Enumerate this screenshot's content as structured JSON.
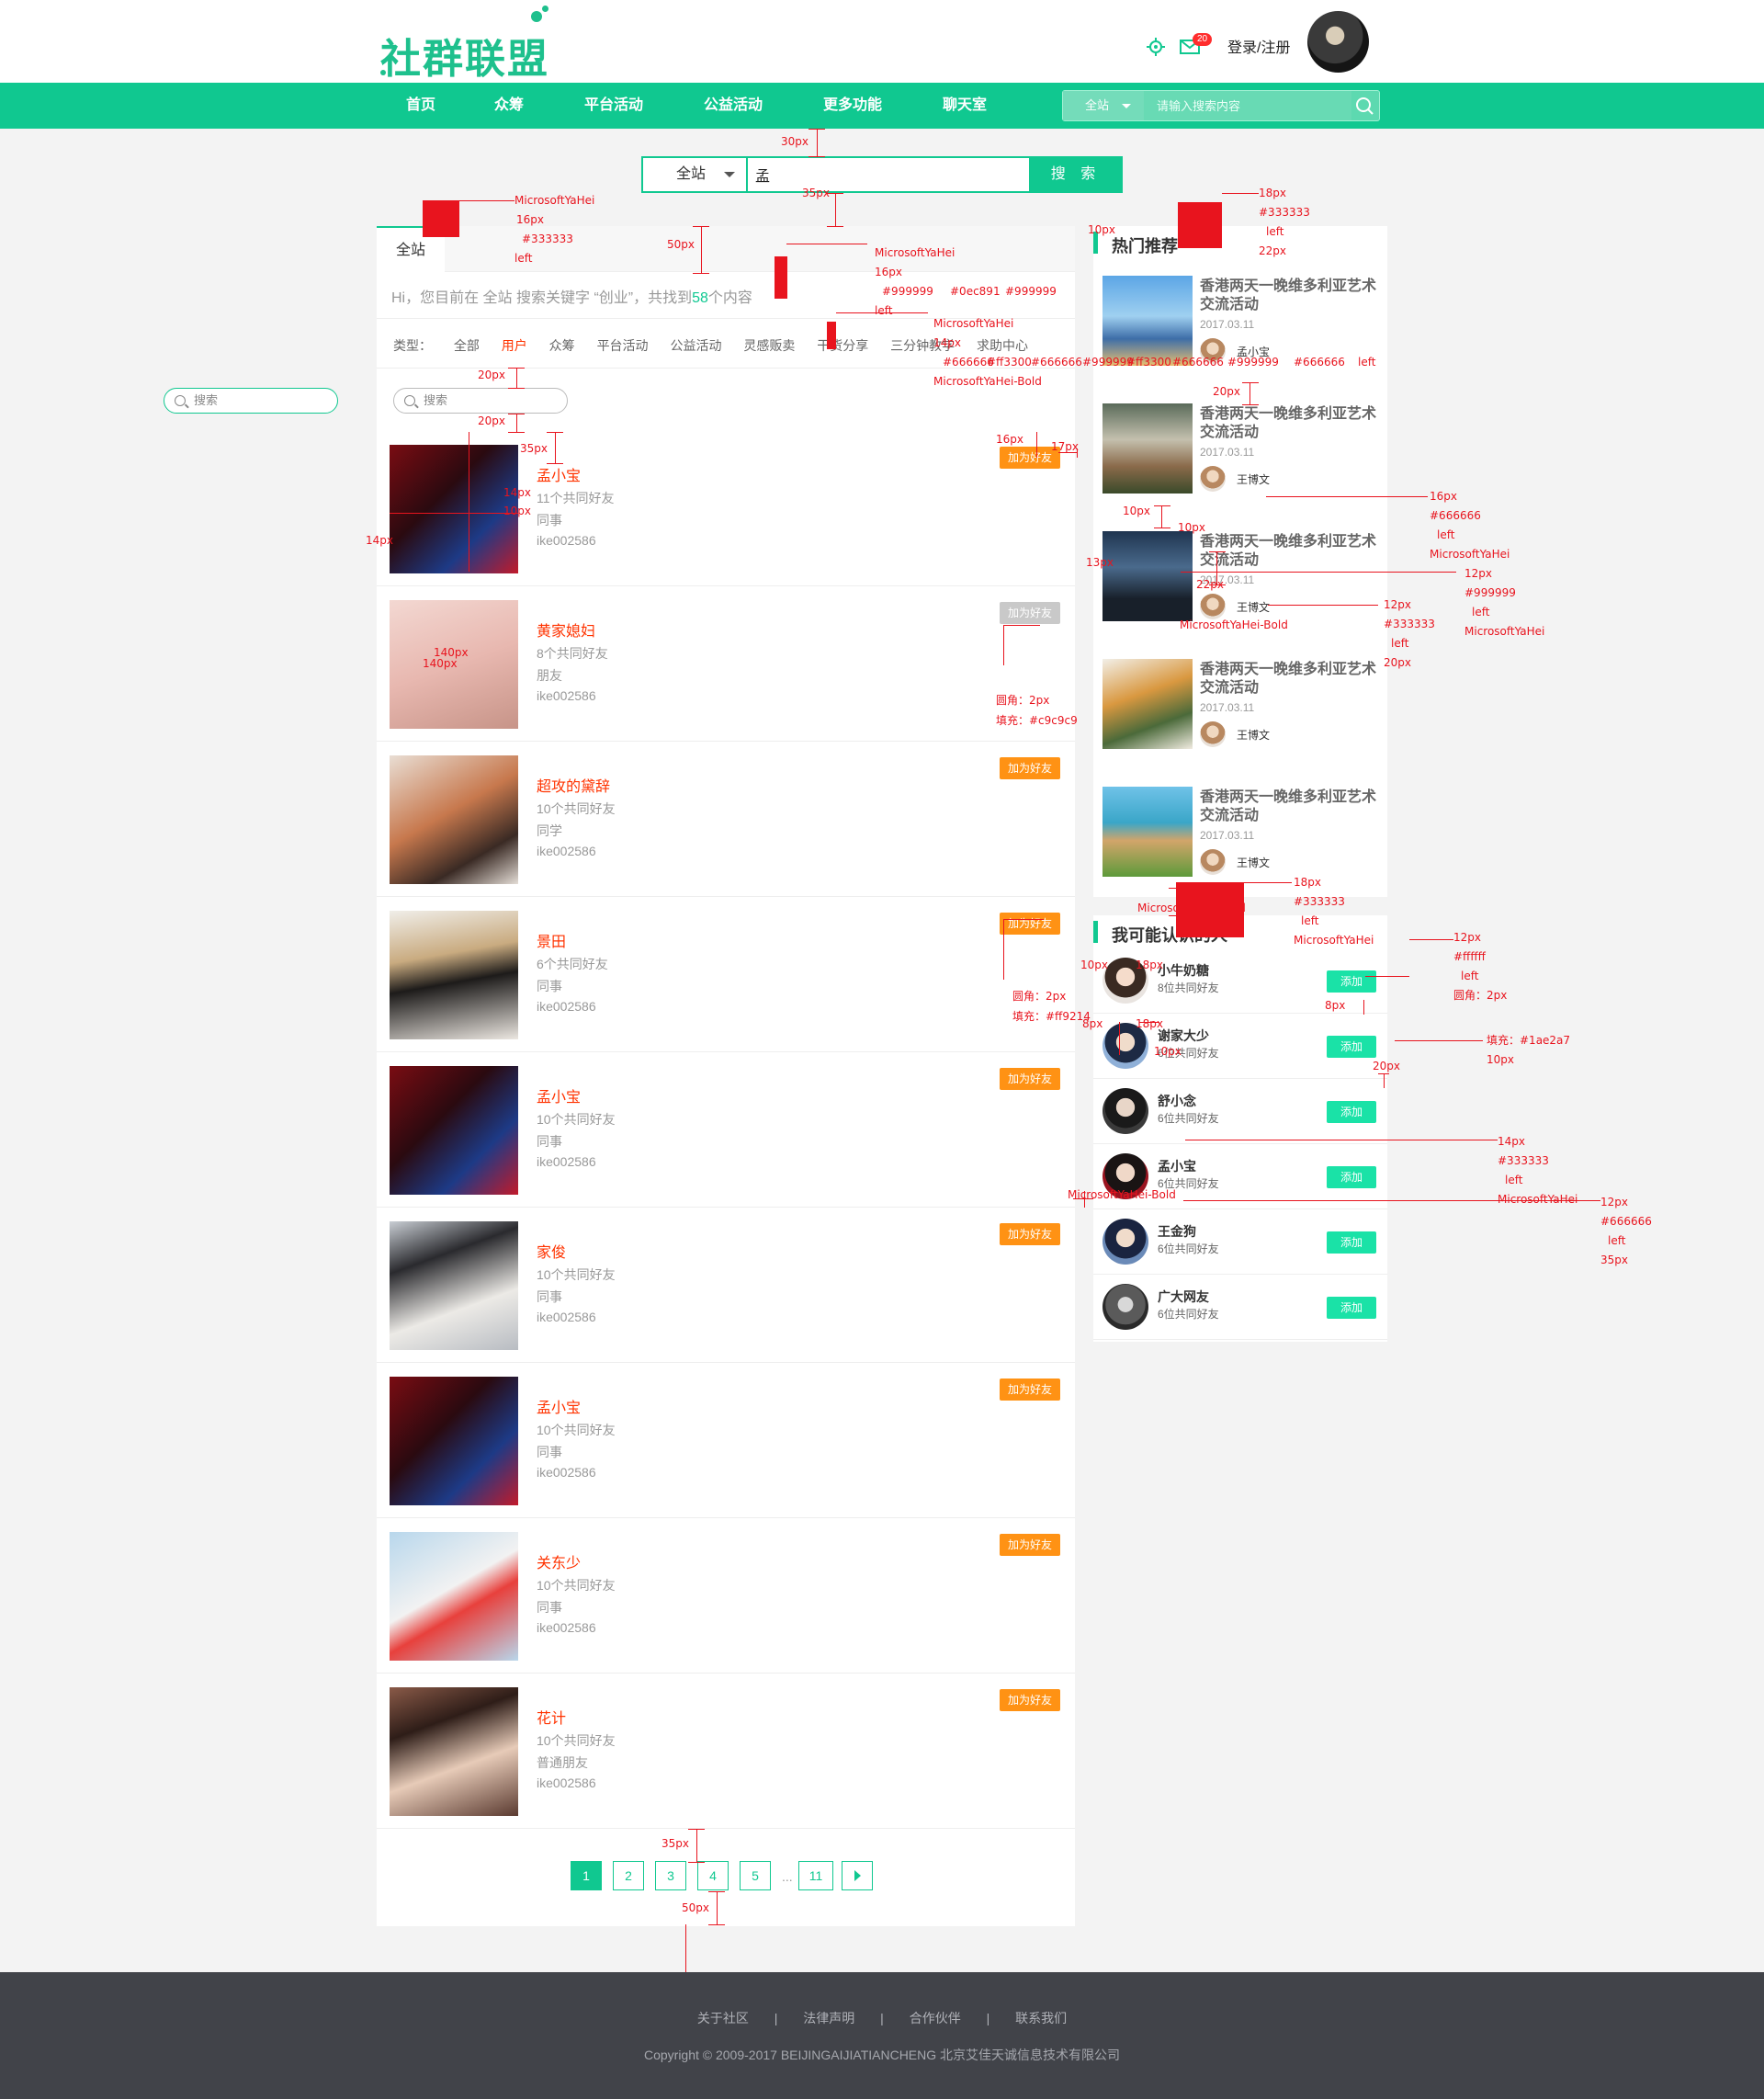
{
  "header": {
    "logo_text": "社群联盟",
    "message_count": "20",
    "login_label": "登录/注册",
    "icons": [
      "gear-icon",
      "mail-icon"
    ]
  },
  "nav": {
    "items": [
      "首页",
      "众筹",
      "平台活动",
      "公益活动",
      "更多功能",
      "聊天室"
    ],
    "search_scope": "全站",
    "search_placeholder": "请输入搜索内容"
  },
  "main_search": {
    "scope": "全站",
    "query": "孟",
    "button": "搜 索"
  },
  "results": {
    "tab": "全站",
    "info_pre": "Hi，您目前在 全站 搜索关键字 “创业”，共找到",
    "count": "58",
    "info_post": "个内容",
    "type_label": "类型：",
    "types": [
      "全部",
      "用户",
      "众筹",
      "平台活动",
      "公益活动",
      "灵感贩卖",
      "干货分享",
      "三分钟教学",
      "求助中心"
    ],
    "search_placeholder": "搜索",
    "users": [
      {
        "name": "孟小宝",
        "mutual": "11个共同好友",
        "relation": "同事",
        "id": "ike002586",
        "button": "加为好友"
      },
      {
        "name": "黄家媳妇",
        "mutual": "8个共同好友",
        "relation": "朋友",
        "id": "ike002586",
        "button": "加为好友"
      },
      {
        "name": "超攻的黛辞",
        "mutual": "10个共同好友",
        "relation": "同学",
        "id": "ike002586",
        "button": "加为好友"
      },
      {
        "name": "景田",
        "mutual": "6个共同好友",
        "relation": "同事",
        "id": "ike002586",
        "button": "加为好友"
      },
      {
        "name": "孟小宝",
        "mutual": "10个共同好友",
        "relation": "同事",
        "id": "ike002586",
        "button": "加为好友"
      },
      {
        "name": "家俊",
        "mutual": "10个共同好友",
        "relation": "同事",
        "id": "ike002586",
        "button": "加为好友"
      },
      {
        "name": "孟小宝",
        "mutual": "10个共同好友",
        "relation": "同事",
        "id": "ike002586",
        "button": "加为好友"
      },
      {
        "name": "关东少",
        "mutual": "10个共同好友",
        "relation": "同事",
        "id": "ike002586",
        "button": "加为好友"
      },
      {
        "name": "花计",
        "mutual": "10个共同好友",
        "relation": "普通朋友",
        "id": "ike002586",
        "button": "加为好友"
      }
    ],
    "pages": [
      "1",
      "2",
      "3",
      "4",
      "5",
      "...",
      "11"
    ]
  },
  "side_search_placeholder": "搜索",
  "hot": {
    "title": "热门推荐",
    "items": [
      {
        "title": "香港两天一晚维多利亚艺术交流活动",
        "date": "2017.03.11",
        "author": "孟小宝"
      },
      {
        "title": "香港两天一晚维多利亚艺术交流活动",
        "date": "2017.03.11",
        "author": "王博文"
      },
      {
        "title": "香港两天一晚维多利亚艺术交流活动",
        "date": "2017.03.11",
        "author": "王博文"
      },
      {
        "title": "香港两天一晚维多利亚艺术交流活动",
        "date": "2017.03.11",
        "author": "王博文"
      },
      {
        "title": "香港两天一晚维多利亚艺术交流活动",
        "date": "2017.03.11",
        "author": "王博文"
      }
    ]
  },
  "people": {
    "title": "我可能认识的人",
    "items": [
      {
        "name": "小牛奶糖",
        "sub": "8位共同好友",
        "button": "添加"
      },
      {
        "name": "谢家大少",
        "sub": "6位共同好友",
        "button": "添加"
      },
      {
        "name": "舒小念",
        "sub": "6位共同好友",
        "button": "添加"
      },
      {
        "name": "孟小宝",
        "sub": "6位共同好友",
        "button": "添加"
      },
      {
        "name": "王金狗",
        "sub": "6位共同好友",
        "button": "添加"
      },
      {
        "name": "广大网友",
        "sub": "6位共同好友",
        "button": "添加"
      }
    ]
  },
  "annotations": [
    "30px",
    "35px",
    "50px",
    "10px",
    "20px",
    "20px",
    "35px",
    "16px",
    "17px",
    "14px",
    "14px",
    "10px",
    "140px",
    "140px",
    "圆角：2px",
    "填充：#c9c9c9",
    "圆角：2px",
    "填充：#ff9214",
    "MicrosoftYaHei",
    "16px",
    "#333333",
    "left",
    "MicrosoftYaHei",
    "16px",
    "#999999",
    "#0ec891",
    "#999999",
    "left",
    "MicrosoftYaHei",
    "14px",
    "#666666",
    "#ff3300",
    "#666666",
    "#999999",
    "#ff3300",
    "#666666",
    "#999999",
    "#666666",
    "left",
    "MicrosoftYaHei-Bold",
    "18px",
    "#333333",
    "left",
    "22px",
    "20px",
    "10px",
    "10px",
    "13px",
    "22px",
    "MicrosoftYaHei-Bold",
    "16px",
    "#666666",
    "left",
    "MicrosoftYaHei",
    "12px",
    "#999999",
    "left",
    "MicrosoftYaHei",
    "12px",
    "#333333",
    "left",
    "20px",
    "MicrosoftYaHei-Bold",
    "18px",
    "#333333",
    "left",
    "MicrosoftYaHei",
    "12px",
    "#ffffff",
    "left",
    "圆角：2px",
    "填充：#1ae2a7",
    "10px",
    "10px",
    "18px",
    "18px",
    "8px",
    "10px",
    "8px",
    "20px",
    "MicrosoftYaHei-Bold",
    "14px",
    "#333333",
    "left",
    "MicrosoftYaHei",
    "12px",
    "#666666",
    "left",
    "35px",
    "35px",
    "50px"
  ],
  "footer": {
    "links": [
      "关于社区",
      "|",
      "法律声明",
      "|",
      "合作伙伴",
      "|",
      "联系我们"
    ],
    "copyright": "Copyright © 2009-2017 BEIJINGAIJIATIANCHENG 北京艾佳天诚信息技术有限公司"
  },
  "colors": {
    "brand": "#10c890",
    "accent": "#ff3300",
    "add_friend": "#ff9214",
    "add": "#1ae2a7",
    "annotation": "#e8141e"
  }
}
